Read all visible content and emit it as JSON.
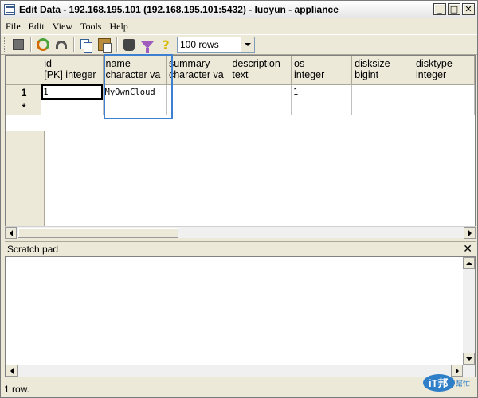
{
  "window": {
    "title": "Edit Data - 192.168.195.101 (192.168.195.101:5432) - luoyun - appliance",
    "minimize_glyph": "_",
    "maximize_glyph": "□",
    "close_glyph": "✕"
  },
  "menu": [
    "File",
    "Edit",
    "View",
    "Tools",
    "Help"
  ],
  "toolbar": {
    "icons": [
      "stop-icon",
      "refresh-icon",
      "undo-icon",
      "copy-icon",
      "paste-icon",
      "delete-icon",
      "filter-icon",
      "help-icon"
    ],
    "rows_selected": "100 rows"
  },
  "grid": {
    "columns": [
      {
        "name": "id",
        "type": "[PK] integer"
      },
      {
        "name": "name",
        "type": "character va"
      },
      {
        "name": "summary",
        "type": "character va"
      },
      {
        "name": "description",
        "type": "text"
      },
      {
        "name": "os",
        "type": "integer"
      },
      {
        "name": "disksize",
        "type": "bigint"
      },
      {
        "name": "disktype",
        "type": "integer"
      }
    ],
    "rows": [
      {
        "header": "1",
        "cells": [
          "1",
          "MyOwnCloud",
          "",
          "",
          "1",
          "",
          ""
        ]
      },
      {
        "header": "*",
        "cells": [
          "",
          "",
          "",
          "",
          "",
          "",
          ""
        ]
      }
    ]
  },
  "scratch": {
    "title": "Scratch pad",
    "close_glyph": "✕"
  },
  "status": {
    "text": "1 row."
  },
  "logo": {
    "text": "iT邦",
    "subtext": "幫忙"
  },
  "colors": {
    "highlight": "#3d7fd1",
    "logo": "#2f7fc8"
  }
}
